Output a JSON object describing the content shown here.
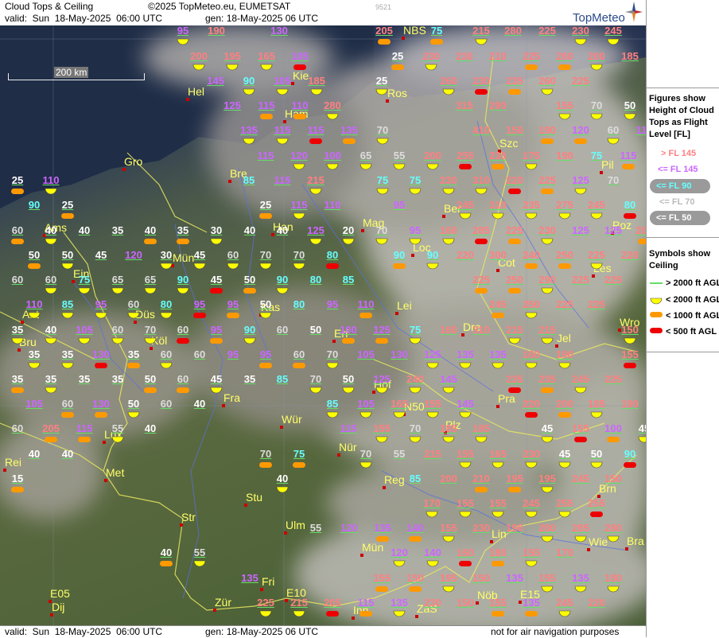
{
  "header": {
    "title": "Cloud Tops & Ceiling",
    "copyright": "©2025 TopMeteo.eu, EUMETSAT",
    "valid": "valid:  Sun  18-May-2025  06:00 UTC",
    "gen": "gen: 18-May-2025 06 UTC",
    "code": "9521",
    "brand": "TopMeteo"
  },
  "footer": {
    "valid": "valid:  Sun  18-May-2025  06:00 UTC",
    "gen": "gen: 18-May-2025 06 UTC",
    "disclaimer": "not for air navigation purposes"
  },
  "scale": {
    "label": "200 km"
  },
  "legend": {
    "figures_title": "Figures show Height of Cloud Tops as Flight Level  [FL]",
    "figures_title_lines": [
      "Figures show",
      "Height of Cloud",
      "Tops as Flight",
      "Level  [FL]"
    ],
    "fl_items": [
      {
        "label": "> FL 145",
        "color": "#ff8080"
      },
      {
        "label": "<= FL 145",
        "color": "#cc66ff"
      },
      {
        "label": "<= FL 90",
        "color": "#66ffff"
      },
      {
        "label": "<= FL 70",
        "color": "#dddddd"
      },
      {
        "label": "<= FL 50",
        "color": "#ffffff"
      }
    ],
    "symbols_title_lines": [
      "Symbols show",
      "Ceiling"
    ],
    "symbol_items": [
      {
        "label": "> 2000 ft AGL",
        "kind": "line",
        "color": "#66ff66"
      },
      {
        "label": "< 2000 ft AGL",
        "kind": "half",
        "color": "#ffff00"
      },
      {
        "label": "< 1000 ft AGL",
        "kind": "pill",
        "color": "#ff9900"
      },
      {
        "label": "< 500 ft AGL",
        "kind": "pill",
        "color": "#ee0000"
      }
    ]
  },
  "cities": [
    {
      "name": "Hel"
    },
    {
      "name": "Kie"
    },
    {
      "name": "Ros"
    },
    {
      "name": "NBS"
    },
    {
      "name": "Ham"
    },
    {
      "name": "Gro"
    },
    {
      "name": "Bre"
    },
    {
      "name": "Szc"
    },
    {
      "name": "Pil"
    },
    {
      "name": "Ber"
    },
    {
      "name": "Ams"
    },
    {
      "name": "Han"
    },
    {
      "name": "Poz"
    },
    {
      "name": "Mün"
    },
    {
      "name": "Mag"
    },
    {
      "name": "Loc"
    },
    {
      "name": "Cot"
    },
    {
      "name": "Les"
    },
    {
      "name": "Ein"
    },
    {
      "name": "Ant"
    },
    {
      "name": "Kas"
    },
    {
      "name": "Lei"
    },
    {
      "name": "Düs"
    },
    {
      "name": "Wro"
    },
    {
      "name": "Bru"
    },
    {
      "name": "Köl"
    },
    {
      "name": "Erf"
    },
    {
      "name": "Dre"
    },
    {
      "name": "Jel"
    },
    {
      "name": "Hof"
    },
    {
      "name": "Fra"
    },
    {
      "name": "N50"
    },
    {
      "name": "Pra"
    },
    {
      "name": "Lux"
    },
    {
      "name": "Wür"
    },
    {
      "name": "Plz"
    },
    {
      "name": "Nür"
    },
    {
      "name": "Rei"
    },
    {
      "name": "Met"
    },
    {
      "name": "Brn"
    },
    {
      "name": "Reg"
    },
    {
      "name": "Stu"
    },
    {
      "name": "Str"
    },
    {
      "name": "Ulm"
    },
    {
      "name": "Lin"
    },
    {
      "name": "Wie"
    },
    {
      "name": "Bra"
    },
    {
      "name": "Mün"
    },
    {
      "name": "Fri"
    },
    {
      "name": "E10"
    },
    {
      "name": "E15"
    },
    {
      "name": "E05"
    },
    {
      "name": "Dij"
    },
    {
      "name": "Zür"
    },
    {
      "name": "Inn"
    },
    {
      "name": "ZaS"
    },
    {
      "name": "Nöb"
    }
  ],
  "cloud_tops": [
    "95",
    "190",
    "130",
    "205",
    "75",
    "215",
    "280",
    "225",
    "230",
    "245",
    "200",
    "195",
    "165",
    "105",
    "25",
    "230",
    "230",
    "210",
    "225",
    "260",
    "200",
    "185",
    "145",
    "90",
    "105",
    "185",
    "25",
    "260",
    "230",
    "235",
    "260",
    "225",
    "125",
    "115",
    "110",
    "280",
    "315",
    "290",
    "155",
    "70",
    "50",
    "135",
    "115",
    "115",
    "135",
    "70",
    "410",
    "150",
    "190",
    "120",
    "60",
    "115",
    "115",
    "120",
    "100",
    "65",
    "55",
    "200",
    "255",
    "230",
    "175",
    "190",
    "75",
    "115",
    "25",
    "110",
    "85",
    "115",
    "215",
    "75",
    "75",
    "230",
    "310",
    "220",
    "225",
    "125",
    "70",
    "90",
    "25",
    "25",
    "115",
    "110",
    "95",
    "245",
    "310",
    "235",
    "275",
    "245",
    "80",
    "60",
    "40",
    "40",
    "35",
    "40",
    "35",
    "30",
    "40",
    "40",
    "125",
    "20",
    "70",
    "95",
    "160",
    "285",
    "225",
    "230",
    "125",
    "125",
    "205",
    "50",
    "50",
    "45",
    "120",
    "30",
    "45",
    "60",
    "70",
    "70",
    "80",
    "90",
    "90",
    "220",
    "300",
    "240",
    "250",
    "225",
    "220",
    "60",
    "60",
    "75",
    "65",
    "65",
    "90",
    "45",
    "50",
    "90",
    "80",
    "85",
    "225",
    "250",
    "290",
    "225",
    "225",
    "110",
    "85",
    "95",
    "60",
    "80",
    "95",
    "95",
    "50",
    "80",
    "95",
    "110",
    "245",
    "250",
    "225",
    "225",
    "35",
    "40",
    "105",
    "60",
    "70",
    "60",
    "95",
    "90",
    "60",
    "50",
    "100",
    "125",
    "75",
    "160",
    "310",
    "215",
    "215",
    "150",
    "35",
    "35",
    "130",
    "35",
    "60",
    "60",
    "95",
    "95",
    "60",
    "70",
    "105",
    "130",
    "125",
    "135",
    "135",
    "160",
    "190",
    "155",
    "35",
    "35",
    "35",
    "35",
    "50",
    "60",
    "45",
    "35",
    "85",
    "70",
    "50",
    "125",
    "240",
    "145",
    "235",
    "235",
    "245",
    "225",
    "105",
    "60",
    "130",
    "50",
    "60",
    "40",
    "85",
    "105",
    "165",
    "155",
    "145",
    "220",
    "200",
    "185",
    "190",
    "60",
    "205",
    "115",
    "55",
    "40",
    "115",
    "155",
    "70",
    "185",
    "185",
    "45",
    "155",
    "100",
    "45",
    "40",
    "40",
    "70",
    "75",
    "70",
    "55",
    "215",
    "155",
    "165",
    "230",
    "45",
    "50",
    "90",
    "15",
    "40",
    "85",
    "200",
    "210",
    "195",
    "195",
    "245",
    "150",
    "170",
    "155",
    "155",
    "245",
    "255",
    "255",
    "40",
    "55",
    "55",
    "120",
    "135",
    "140",
    "155",
    "230",
    "190",
    "280",
    "285",
    "280",
    "120",
    "140",
    "160",
    "180",
    "155",
    "170",
    "135",
    "155",
    "150",
    "195",
    "150",
    "135",
    "155",
    "135",
    "180",
    "225",
    "215",
    "205",
    "115",
    "135",
    "230",
    "150",
    "155",
    "135",
    "245",
    "220"
  ]
}
